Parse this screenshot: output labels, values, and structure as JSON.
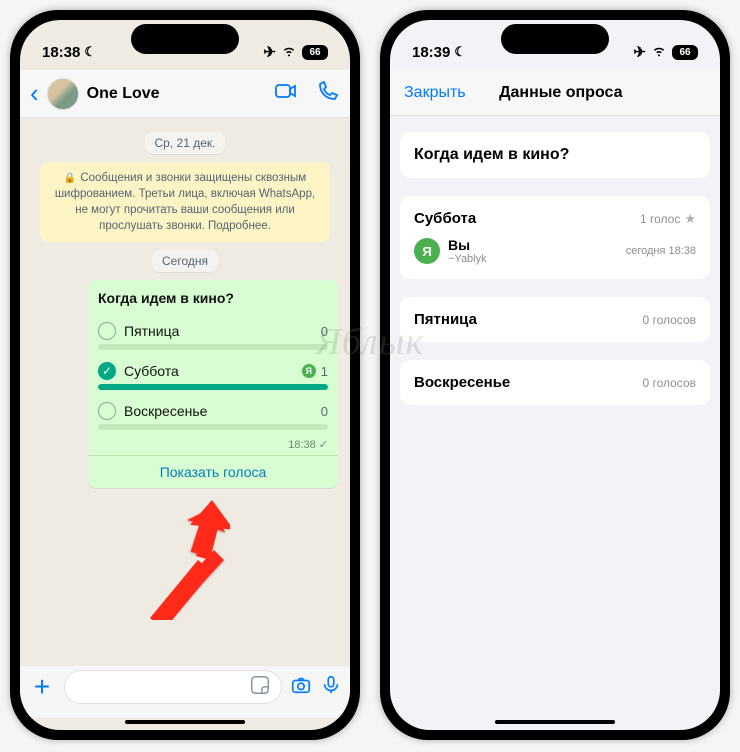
{
  "watermark": "Яблык",
  "left": {
    "status": {
      "time": "18:38",
      "battery": "66"
    },
    "chat_title": "One Love",
    "date_chip": "Ср, 21 дек.",
    "encryption_notice": "Сообщения и звонки защищены сквозным шифрованием. Третьи лица, включая WhatsApp, не могут прочитать ваши сообщения или прослушать звонки. Подробнее.",
    "today_chip": "Сегодня",
    "poll": {
      "question": "Когда идем в кино?",
      "options": [
        {
          "label": "Пятница",
          "count": "0",
          "selected": false,
          "fill": 0
        },
        {
          "label": "Суббота",
          "count": "1",
          "selected": true,
          "fill": 100
        },
        {
          "label": "Воскресенье",
          "count": "0",
          "selected": false,
          "fill": 0
        }
      ],
      "timestamp": "18:38",
      "show_votes": "Показать голоса"
    }
  },
  "right": {
    "status": {
      "time": "18:39",
      "battery": "66"
    },
    "close": "Закрыть",
    "title": "Данные опроса",
    "question": "Когда идем в кино?",
    "results": [
      {
        "label": "Суббота",
        "meta": "1 голос",
        "starred": true,
        "voters": [
          {
            "avatar": "Я",
            "name": "Вы",
            "sub": "~Yablyk",
            "time": "сегодня 18:38"
          }
        ]
      },
      {
        "label": "Пятница",
        "meta": "0 голосов",
        "starred": false,
        "voters": []
      },
      {
        "label": "Воскресенье",
        "meta": "0 голосов",
        "starred": false,
        "voters": []
      }
    ]
  }
}
